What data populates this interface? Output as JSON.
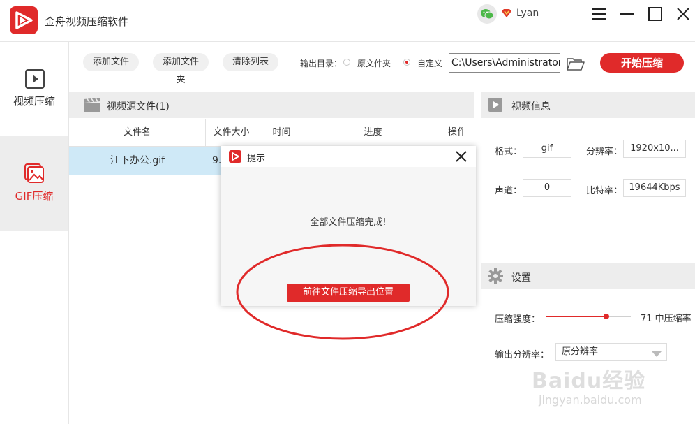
{
  "app": {
    "title": "金舟视频压缩软件",
    "username": "Lyan",
    "accent_color": "#e02a2a"
  },
  "nav": {
    "items": [
      {
        "label": "视频压缩",
        "icon": "play-icon",
        "active": false
      },
      {
        "label": "GIF压缩",
        "icon": "image-icon",
        "active": true
      }
    ]
  },
  "toolbar": {
    "add_file": "添加文件",
    "add_folder": "添加文件夹",
    "clear_list": "清除列表",
    "output_dir_label": "输出目录：",
    "option_original": "原文件夹",
    "option_custom": "自定义",
    "path_value": "C:\\Users\\Administrator\\",
    "start_button": "开始压缩"
  },
  "file_list": {
    "title": "视频源文件(1)",
    "columns": [
      "文件名",
      "文件大小",
      "时间",
      "进度",
      "操作"
    ],
    "rows": [
      {
        "name": "江下办公.gif",
        "size": "9."
      }
    ]
  },
  "video_info": {
    "title": "视频信息",
    "format_label": "格式：",
    "format_value": "gif",
    "resolution_label": "分辨率：",
    "resolution_value": "1920x10...",
    "channel_label": "声道：",
    "channel_value": "0",
    "bitrate_label": "比特率：",
    "bitrate_value": "19644Kbps"
  },
  "settings": {
    "title": "设置",
    "strength_label": "压缩强度：",
    "strength_value": 71,
    "strength_text": "71 中压缩率",
    "output_res_label": "输出分辨率：",
    "output_res_value": "原分辨率"
  },
  "dialog": {
    "title": "提示",
    "message": "全部文件压缩完成!",
    "button": "前往文件压缩导出位置"
  },
  "watermark": {
    "text": "Baidu经验",
    "sub": "jingyan.baidu.com"
  }
}
